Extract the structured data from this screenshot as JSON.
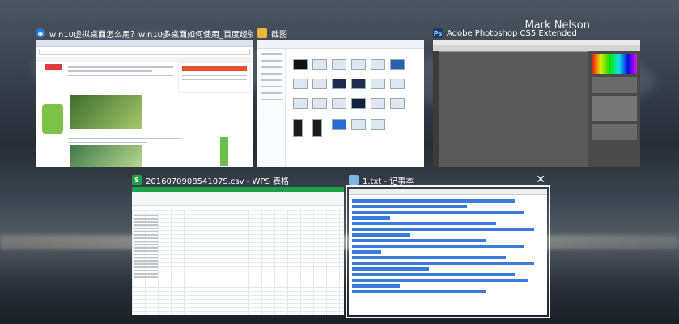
{
  "user_name": "Mark Nelson",
  "windows": [
    {
      "title": "win10虚拟桌面怎么用？win10多桌面如何使用_百度经验 - 世界之窗浏...",
      "icon": "browser-globe-icon"
    },
    {
      "title": "截图",
      "icon": "folder-icon"
    },
    {
      "title": "Adobe Photoshop CS5 Extended",
      "icon": "photoshop-icon",
      "icon_text": "Ps"
    },
    {
      "title": "201607090854107S.csv - WPS 表格",
      "icon": "wps-spreadsheet-icon",
      "icon_text": "S"
    },
    {
      "title": "1.txt - 记事本",
      "icon": "notepad-icon"
    }
  ],
  "close_glyph": "✕",
  "colors": {
    "selection": "#f4f7fb",
    "ps_blue": "#1f3a66",
    "wps_green": "#1aa34a",
    "notepad_highlight": "#3b7bdc"
  }
}
